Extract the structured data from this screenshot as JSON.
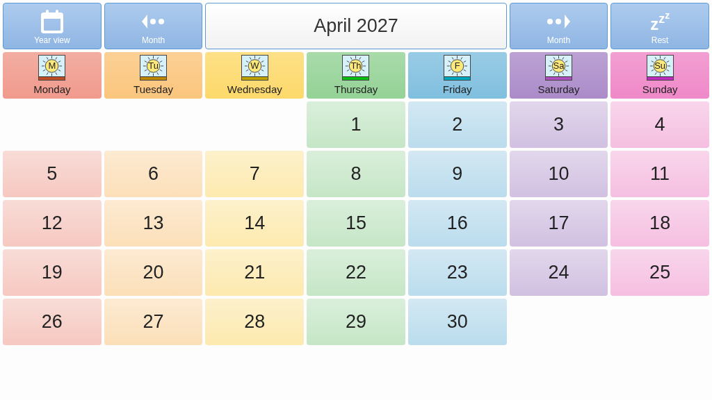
{
  "toolbar": {
    "left_buttons": [
      {
        "kind": "calendar",
        "label": "Year view"
      },
      {
        "kind": "prev",
        "label": "Month"
      }
    ],
    "title": "April 2027",
    "right_buttons": [
      {
        "kind": "next",
        "label": "Month"
      },
      {
        "kind": "sleep",
        "label": "Rest",
        "glyph": "zzz"
      }
    ]
  },
  "days": [
    {
      "name": "Monday",
      "abbr": "M",
      "color": "#f09a8c"
    },
    {
      "name": "Tuesday",
      "abbr": "Tu",
      "color": "#fbc57c"
    },
    {
      "name": "Wednesday",
      "abbr": "W",
      "color": "#fdd96a"
    },
    {
      "name": "Thursday",
      "abbr": "Th",
      "color": "#94d296"
    },
    {
      "name": "Friday",
      "abbr": "F",
      "color": "#80bfdf"
    },
    {
      "name": "Saturday",
      "abbr": "Sa",
      "color": "#ab8bc9"
    },
    {
      "name": "Sunday",
      "abbr": "Su",
      "color": "#ef88c8"
    }
  ],
  "weeks": [
    [
      {
        "kind": "blank"
      },
      {
        "kind": "blank"
      },
      {
        "kind": "blank"
      },
      {
        "kind": "date",
        "day": "1"
      },
      {
        "kind": "date",
        "day": "2"
      },
      {
        "kind": "date",
        "day": "3"
      },
      {
        "kind": "date",
        "day": "4"
      }
    ],
    [
      {
        "kind": "date",
        "day": "5"
      },
      {
        "kind": "date",
        "day": "6"
      },
      {
        "kind": "date",
        "day": "7"
      },
      {
        "kind": "date",
        "day": "8"
      },
      {
        "kind": "date",
        "day": "9"
      },
      {
        "kind": "date",
        "day": "10"
      },
      {
        "kind": "date",
        "day": "11"
      }
    ],
    [
      {
        "kind": "date",
        "day": "12"
      },
      {
        "kind": "date",
        "day": "13"
      },
      {
        "kind": "date",
        "day": "14"
      },
      {
        "kind": "date",
        "day": "15"
      },
      {
        "kind": "date",
        "day": "16"
      },
      {
        "kind": "date",
        "day": "17"
      },
      {
        "kind": "date",
        "day": "18"
      }
    ],
    [
      {
        "kind": "date",
        "day": "19"
      },
      {
        "kind": "date",
        "day": "20"
      },
      {
        "kind": "date",
        "day": "21"
      },
      {
        "kind": "date",
        "day": "22"
      },
      {
        "kind": "date",
        "day": "23"
      },
      {
        "kind": "date",
        "day": "24"
      },
      {
        "kind": "date",
        "day": "25"
      }
    ],
    [
      {
        "kind": "date",
        "day": "26"
      },
      {
        "kind": "date",
        "day": "27"
      },
      {
        "kind": "date",
        "day": "28"
      },
      {
        "kind": "date",
        "day": "29"
      },
      {
        "kind": "date",
        "day": "30"
      },
      {
        "kind": "blank"
      },
      {
        "kind": "blank"
      }
    ]
  ]
}
